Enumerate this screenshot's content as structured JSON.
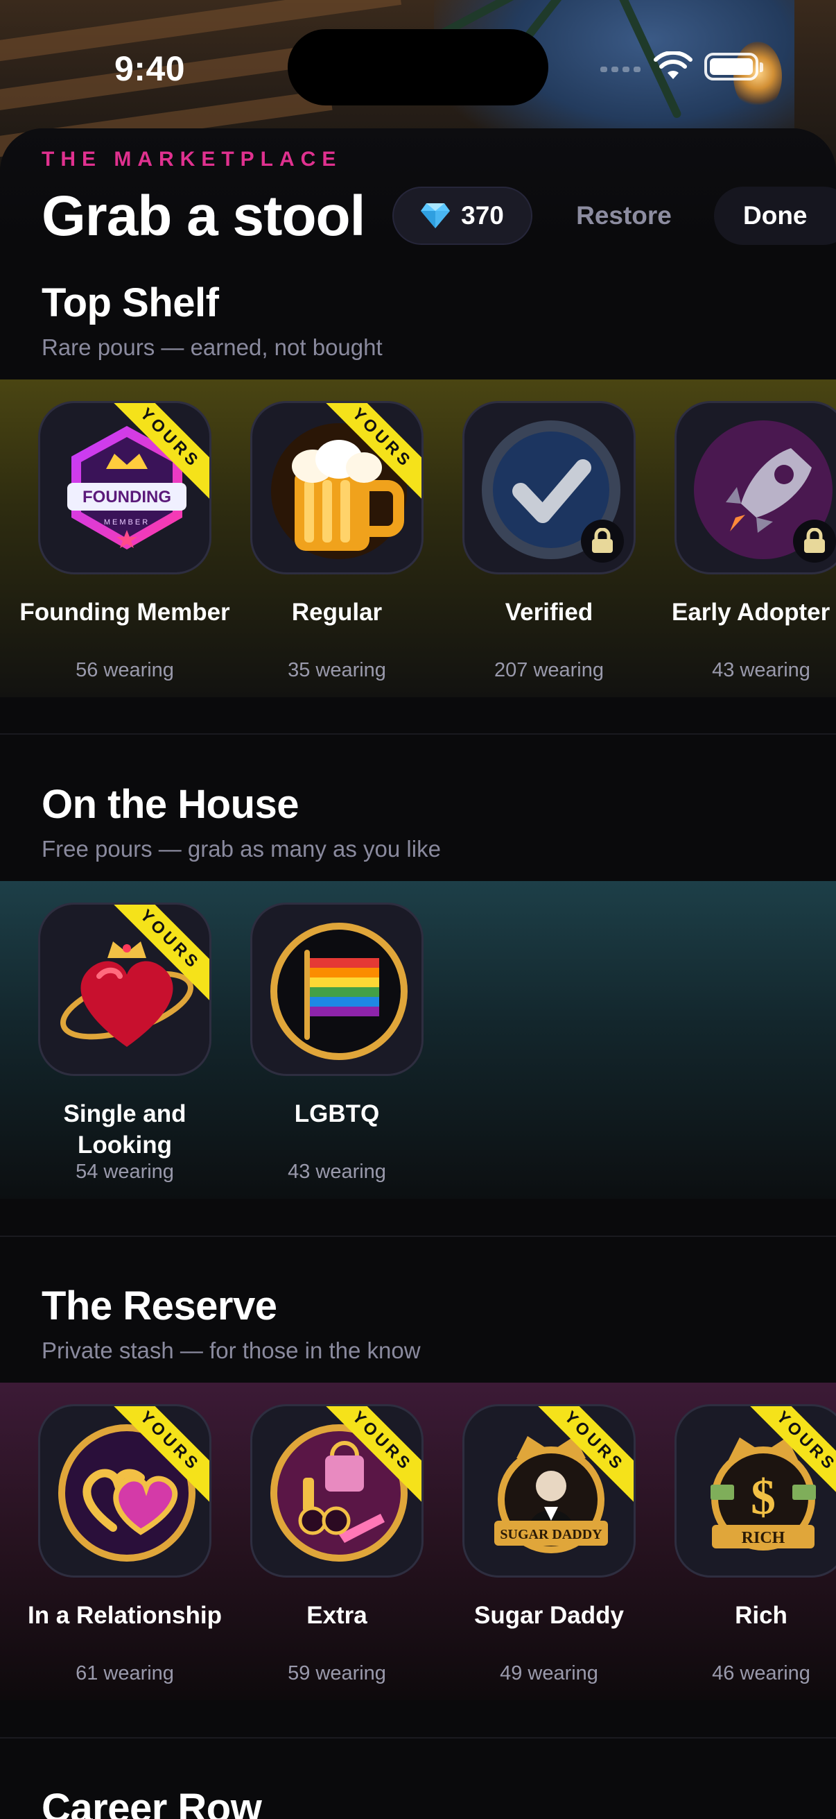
{
  "status_bar": {
    "time": "9:40"
  },
  "header": {
    "eyebrow": "THE MARKETPLACE",
    "title": "Grab a stool",
    "gem_count": "370",
    "restore_label": "Restore",
    "done_label": "Done"
  },
  "colors": {
    "accent": "#e0318f",
    "ribbon": "#f5e21a",
    "background": "#0a0a0c"
  },
  "sections": [
    {
      "title": "Top Shelf",
      "subtitle": "Rare pours — earned, not bought",
      "items": [
        {
          "name": "Founding Member",
          "count": "56 wearing",
          "owned": true,
          "icon": "founding-member-badge-icon",
          "badge_text": "FOUNDING",
          "badge_subtext": "MEMBER"
        },
        {
          "name": "Regular",
          "count": "35 wearing",
          "owned": true,
          "icon": "beer-mug-icon"
        },
        {
          "name": "Verified",
          "count": "207 wearing",
          "owned": false,
          "icon": "verified-check-icon"
        },
        {
          "name": "Early Adopter",
          "count": "43 wearing",
          "owned": false,
          "icon": "rocket-icon"
        }
      ]
    },
    {
      "title": "On the House",
      "subtitle": "Free pours — grab as many as you like",
      "items": [
        {
          "name": "Single and Looking",
          "count": "54 wearing",
          "owned": true,
          "icon": "crowned-heart-icon"
        },
        {
          "name": "LGBTQ",
          "count": "43 wearing",
          "owned": false,
          "icon": "rainbow-flag-icon"
        }
      ]
    },
    {
      "title": "The Reserve",
      "subtitle": "Private stash — for those in the know",
      "items": [
        {
          "name": "In a Relationship",
          "count": "61 wearing",
          "owned": true,
          "icon": "linked-hearts-icon"
        },
        {
          "name": "Extra",
          "count": "59 wearing",
          "owned": true,
          "icon": "glam-accessories-icon"
        },
        {
          "name": "Sugar Daddy",
          "count": "49 wearing",
          "owned": true,
          "icon": "sugar-daddy-crest-icon",
          "badge_text": "SUGAR DADDY"
        },
        {
          "name": "Rich",
          "count": "46 wearing",
          "owned": true,
          "icon": "rich-crest-icon",
          "badge_text": "RICH"
        }
      ]
    },
    {
      "title": "Career Row"
    }
  ],
  "ribbon_label": "YOURS"
}
